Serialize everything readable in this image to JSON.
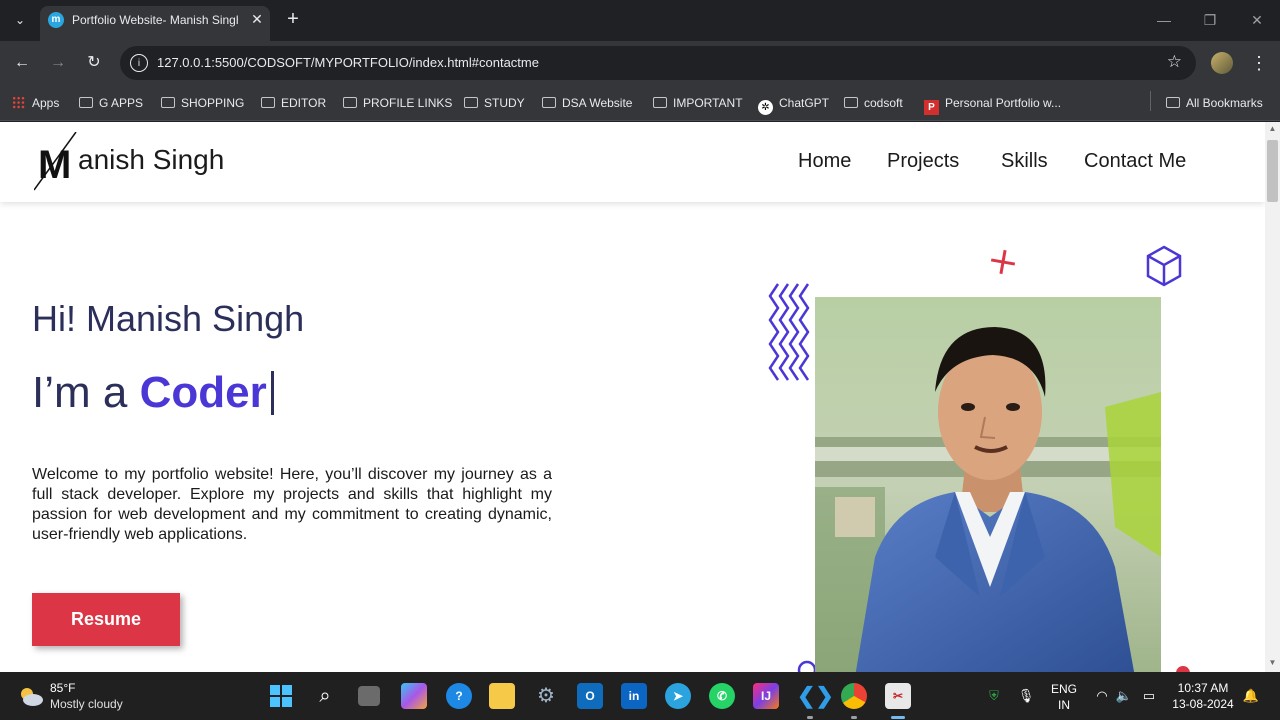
{
  "browser": {
    "tab": {
      "title": "Portfolio Website- Manish Singh",
      "favicon": "m-icon"
    },
    "url": "127.0.0.1:5500/CODSOFT/MYPORTFOLIO/index.html#contactme",
    "bookmarks": [
      {
        "label": "Apps",
        "icon": "apps-grid-icon"
      },
      {
        "label": "G APPS",
        "icon": "folder-icon"
      },
      {
        "label": "SHOPPING",
        "icon": "folder-icon"
      },
      {
        "label": "EDITOR",
        "icon": "folder-icon"
      },
      {
        "label": "PROFILE LINKS",
        "icon": "folder-icon"
      },
      {
        "label": "STUDY",
        "icon": "folder-icon"
      },
      {
        "label": "DSA Website",
        "icon": "folder-icon"
      },
      {
        "label": "IMPORTANT",
        "icon": "folder-icon"
      },
      {
        "label": "ChatGPT",
        "icon": "chatgpt-icon"
      },
      {
        "label": "codsoft",
        "icon": "folder-icon"
      },
      {
        "label": "Personal Portfolio w...",
        "icon": "p-favicon-icon"
      }
    ],
    "all_bookmarks": "All Bookmarks"
  },
  "page": {
    "logo_letter": "M",
    "logo_text": "anish Singh",
    "nav": [
      "Home",
      "Projects",
      "Skills",
      "Contact Me"
    ],
    "greeting": "Hi! Manish Singh",
    "im_prefix": "I’m a ",
    "role": "Coder",
    "intro": "Welcome to my portfolio website! Here, you’ll discover my journey as a full stack developer. Explore my projects and skills that highlight my passion for web development and my commitment to creating dynamic, user-friendly web applications.",
    "resume_label": "Resume",
    "accent_color": "#4a37d6",
    "button_color": "#dc3545",
    "heading_color": "#2b2f5a"
  },
  "taskbar": {
    "weather_temp": "85°F",
    "weather_desc": "Mostly cloudy",
    "language_top": "ENG",
    "language_bottom": "IN",
    "time": "10:37 AM",
    "date": "13-08-2024"
  }
}
